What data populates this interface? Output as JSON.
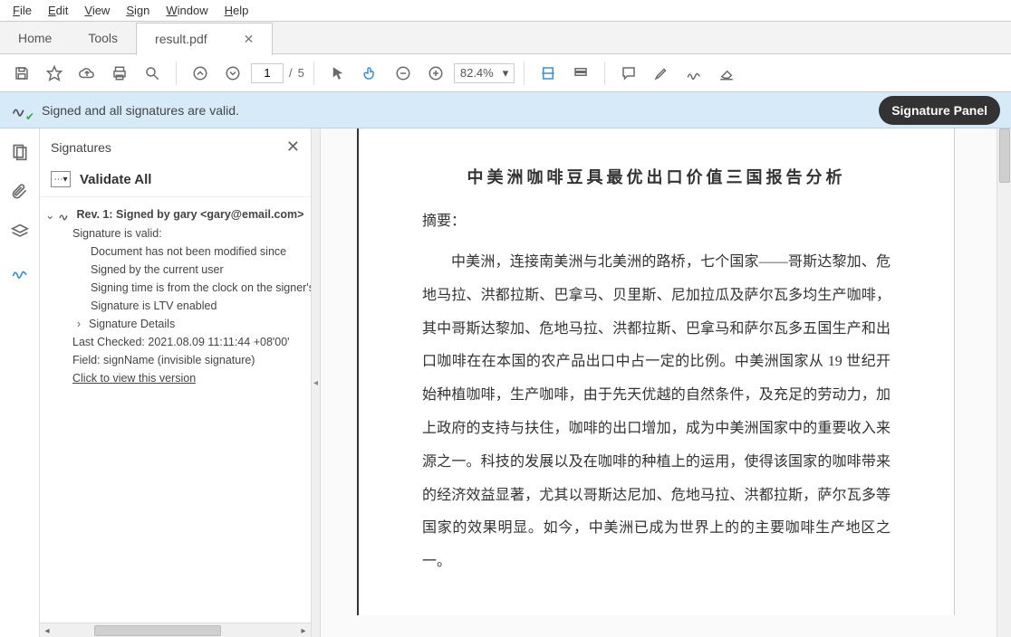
{
  "menu": {
    "file": "File",
    "edit": "Edit",
    "view": "View",
    "sign": "Sign",
    "window": "Window",
    "help": "Help"
  },
  "tabs": {
    "home": "Home",
    "tools": "Tools",
    "doc": "result.pdf"
  },
  "toolbar": {
    "page_current": "1",
    "page_sep": "/",
    "page_total": "5",
    "zoom_value": "82.4%"
  },
  "sigbar": {
    "msg": "Signed and all signatures are valid.",
    "button": "Signature Panel"
  },
  "panel": {
    "title": "Signatures",
    "validate": "Validate All",
    "rev": "Rev. 1: Signed by gary <gary@email.com>",
    "valid": "Signature is valid:",
    "d1": "Document has not been modified since",
    "d2": "Signed by the current user",
    "d3": "Signing time is from the clock on the signer's",
    "d4": "Signature is LTV enabled",
    "details": "Signature Details",
    "last": "Last Checked: 2021.08.09 11:11:44 +08'00'",
    "field": "Field: signName (invisible signature)",
    "clickview": "Click to view this version"
  },
  "document": {
    "title": "中美洲咖啡豆具最优出口价值三国报告分析",
    "abstract_label": "摘要：",
    "body": "中美洲，连接南美洲与北美洲的路桥，七个国家——哥斯达黎加、危地马拉、洪都拉斯、巴拿马、贝里斯、尼加拉瓜及萨尔瓦多均生产咖啡，其中哥斯达黎加、危地马拉、洪都拉斯、巴拿马和萨尔瓦多五国生产和出口咖啡在在本国的农产品出口中占一定的比例。中美洲国家从 19 世纪开始种植咖啡，生产咖啡，由于先天优越的自然条件，及充足的劳动力，加上政府的支持与扶住，咖啡的出口增加，成为中美洲国家中的重要收入来源之一。科技的发展以及在咖啡的种植上的运用，使得该国家的咖啡带来的经济效益显著，尤其以哥斯达尼加、危地马拉、洪都拉斯，萨尔瓦多等国家的效果明显。如今，中美洲已成为世界上的的主要咖啡生产地区之一。"
  }
}
